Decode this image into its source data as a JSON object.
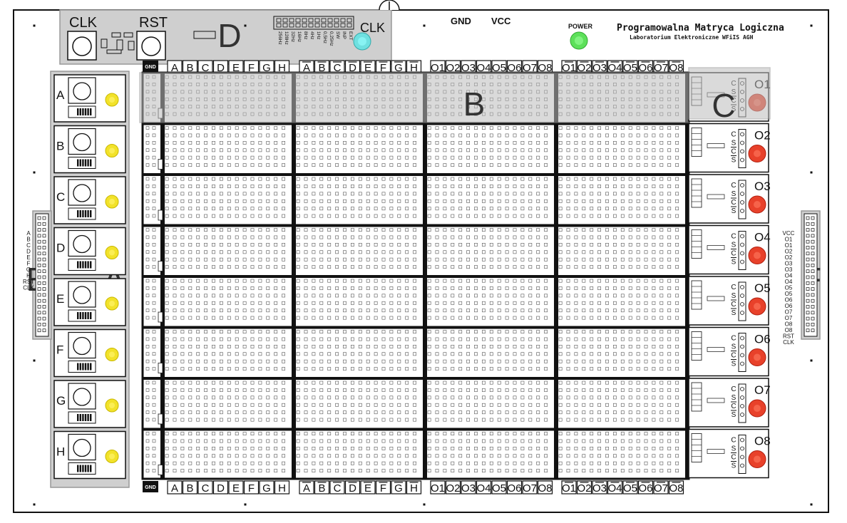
{
  "board": {
    "title": "Programowalna Matryca Logiczna",
    "subtitle": "Laboratorium Elektroniczne WFiIS AGH",
    "power_label": "POWER",
    "gnd_label": "GND",
    "vcc_label": "VCC",
    "clk_label": "CLK",
    "rst_label": "RST",
    "clk_led_label": "CLK",
    "colors": {
      "board": "#ffffff",
      "silkscreen": "#111111",
      "region": "#c8c8c8",
      "led_yellow": "#f2e22a",
      "led_red": "#e8412a",
      "led_green": "#5de05a",
      "led_cyan": "#6fe0e0"
    }
  },
  "regions": {
    "a": "A",
    "b": "B",
    "c": "C",
    "d": "D",
    "e": "E",
    "f": "F"
  },
  "freq_labels": [
    "256Hz",
    "128Hz",
    "32Hz",
    "16Hz",
    "8Hz",
    "4Hz",
    "1Hz",
    "0,5Hz",
    "0,25Hz",
    "SW",
    "INP",
    "EXT"
  ],
  "inputs": [
    "A",
    "B",
    "C",
    "D",
    "E",
    "F",
    "G",
    "H"
  ],
  "header_left_labels": [
    "A",
    "B",
    "C",
    "D",
    "E",
    "F",
    "G",
    "H",
    "RST",
    "CLK"
  ],
  "header_right_labels": [
    "VCC",
    "O1",
    "O1",
    "O2",
    "O2",
    "O3",
    "O3",
    "O4",
    "O4",
    "O5",
    "O5",
    "O6",
    "O6",
    "O7",
    "O7",
    "O8",
    "O8",
    "RST",
    "CLK"
  ],
  "columns": {
    "gnd": "GND",
    "inputs": [
      "A",
      "B",
      "C",
      "D",
      "E",
      "F",
      "G",
      "H"
    ],
    "inverted_inputs": [
      "A",
      "B",
      "C",
      "D",
      "E",
      "F",
      "G",
      "H"
    ],
    "outputs": [
      "O1",
      "O2",
      "O3",
      "O4",
      "O5",
      "O6",
      "O7",
      "O8"
    ],
    "inverted_outputs": [
      "O1",
      "O2",
      "O3",
      "O4",
      "O5",
      "O6",
      "O7",
      "O8"
    ]
  },
  "outputs": [
    {
      "label": "O1",
      "pins": [
        "C",
        "S",
        "C",
        "S"
      ]
    },
    {
      "label": "O2",
      "pins": [
        "C",
        "S",
        "C",
        "S"
      ]
    },
    {
      "label": "O3",
      "pins": [
        "C",
        "S",
        "C",
        "S"
      ]
    },
    {
      "label": "O4",
      "pins": [
        "C",
        "S",
        "C",
        "S"
      ]
    },
    {
      "label": "O5",
      "pins": [
        "C",
        "S",
        "C",
        "S"
      ]
    },
    {
      "label": "O6",
      "pins": [
        "C",
        "S",
        "C",
        "S"
      ]
    },
    {
      "label": "O7",
      "pins": [
        "C",
        "S",
        "C",
        "S"
      ]
    },
    {
      "label": "O8",
      "pins": [
        "C",
        "S",
        "C",
        "S"
      ]
    }
  ]
}
